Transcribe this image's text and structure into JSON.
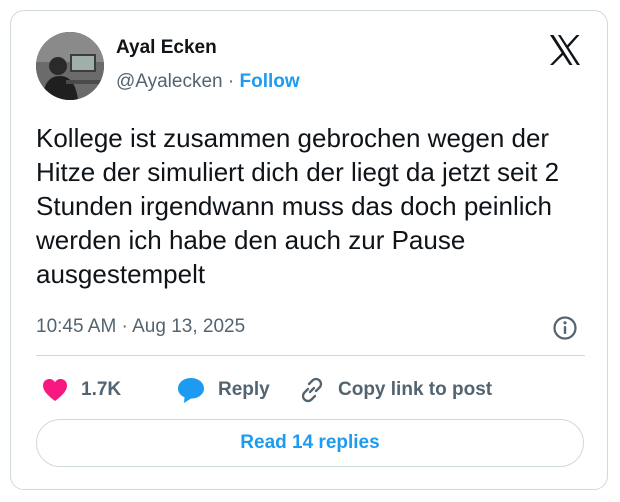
{
  "author": {
    "display_name": "Ayal Ecken",
    "handle": "@Ayalecken",
    "separator": "·",
    "follow_label": "Follow"
  },
  "tweet": {
    "text": "Kollege ist zusammen gebrochen wegen der Hitze der simuliert dich der liegt da jetzt seit 2 Stunden irgendwann muss das doch peinlich werden ich habe den auch zur Pause ausgestempelt",
    "timestamp": "10:45 AM · Aug 13, 2025"
  },
  "actions": {
    "like_count": "1.7K",
    "reply_label": "Reply",
    "copy_label": "Copy link to post"
  },
  "footer": {
    "read_replies_label": "Read 14 replies"
  },
  "icons": {
    "logo": "x-logo-icon",
    "info": "info-icon",
    "like": "heart-icon",
    "reply": "speech-bubble-icon",
    "copy": "link-icon"
  },
  "colors": {
    "accent": "#1d9bf0",
    "like": "#f91880",
    "secondary_text": "#536471",
    "border": "#cfd9de"
  }
}
